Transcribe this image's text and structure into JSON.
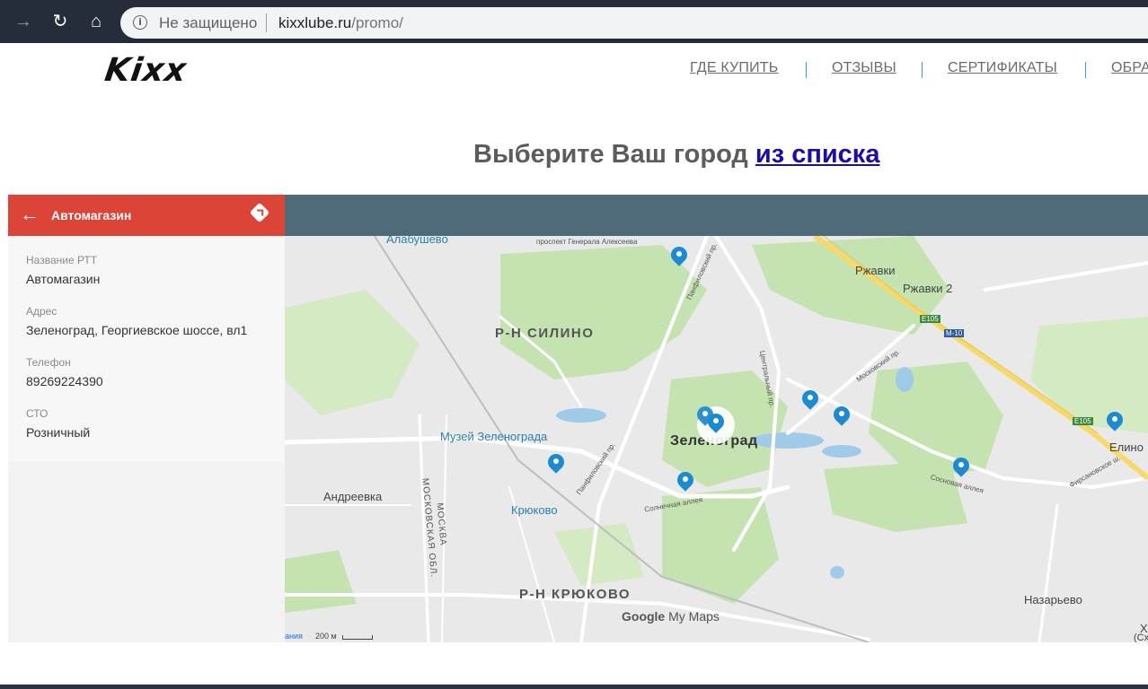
{
  "browser": {
    "security_label": "Не защищено",
    "url_host": "kixxlube.ru",
    "url_path": "/promo/",
    "info_glyph": "i"
  },
  "site": {
    "logo": "Kixx",
    "nav": [
      "ГДЕ КУПИТЬ",
      "ОТЗЫВЫ",
      "СЕРТИФИКАТЫ",
      "ОБРА"
    ],
    "heading_text": "Выберите Ваш город ",
    "heading_link": "из списка"
  },
  "panel": {
    "title": "Автомагазин",
    "fields": [
      {
        "label": "Название РТТ",
        "value": "Автомагазин"
      },
      {
        "label": "Адрес",
        "value": "Зеленоград, Георгиевское шоссе, вл1"
      },
      {
        "label": "Телефон",
        "value": "89269224390"
      },
      {
        "label": "СТО",
        "value": "Розничный"
      }
    ]
  },
  "map": {
    "labels": {
      "alabushevo": "Алабушево",
      "gen_alekseeva": "проспект Генерала Алексеева",
      "silino": "Р-Н СИЛИНО",
      "rzhavki": "Ржавки",
      "rzhavki2": "Ржавки 2",
      "e105a": "E105",
      "m10": "M-10",
      "moskovsky": "Московский пр.",
      "central": "Центральный пр.",
      "panfilovsky_top": "Панфиловский пр.",
      "museum": "Музей Зеленограда",
      "zelenograd": "Зеленоград",
      "e105b": "E105",
      "elino": "Елино",
      "andreevka": "Андреевка",
      "mosk_obl": "МОСКОВСКАЯ ОБЛ.",
      "moskva": "МОСКВА",
      "kryukovo_st": "Крюково",
      "panfilovsky": "Панфиловский пр.",
      "solnechnaya": "Солнечная аллея",
      "sosnovaya": "Сосновая аллея",
      "firsanovskoe": "Фирсановское ш.",
      "kryukovo_district": "Р-Н КРЮКОВО",
      "nazarevo": "Назарьево",
      "kh": "Х",
      "skh": "(Сх"
    },
    "brand_google": "Google",
    "brand_mymaps": "My Maps",
    "scale_left": "ания",
    "scale_value": "200 м",
    "colors": {
      "pin": "#1c8ad1",
      "park": "#c8e6b0",
      "road": "#ffffff",
      "highway": "#f6d96b",
      "water": "#9fcbe8"
    }
  }
}
